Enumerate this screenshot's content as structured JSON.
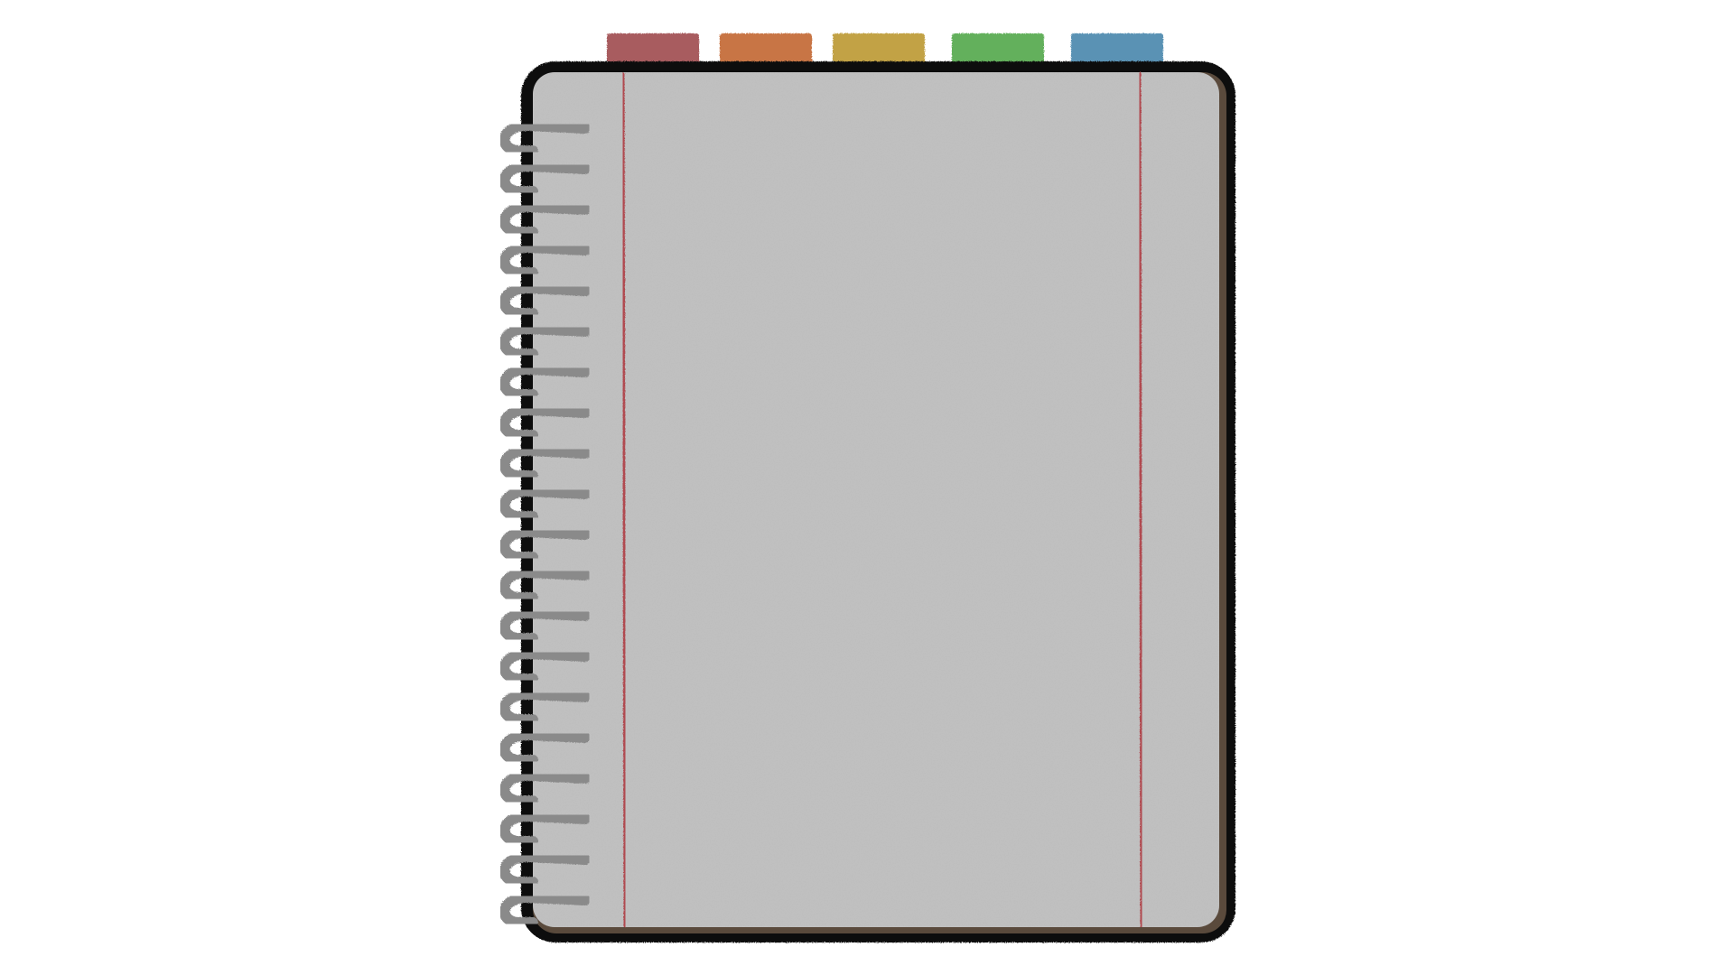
{
  "scene": {
    "background": "#ffffff",
    "notebook": {
      "cover_color": "#111111",
      "cover_edge_color": "#5a4a3c",
      "page_color": "#c2c2c2",
      "margin_line_color": "#b04850",
      "header_line_color": "#7f93c4",
      "spiral_color": "#8a8a8a",
      "spiral_coil_count": 20
    },
    "tabs": [
      {
        "name": "tab-red",
        "color": "#a85c5e"
      },
      {
        "name": "tab-orange",
        "color": "#c87545"
      },
      {
        "name": "tab-yellow",
        "color": "#c2a245"
      },
      {
        "name": "tab-green",
        "color": "#64b05c"
      },
      {
        "name": "tab-blue",
        "color": "#5a92b4"
      }
    ]
  }
}
